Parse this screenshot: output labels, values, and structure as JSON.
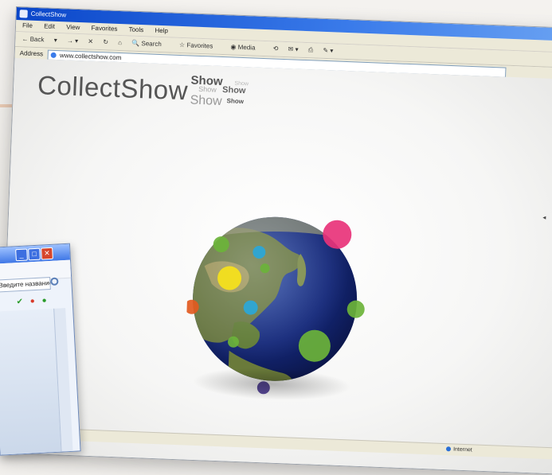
{
  "window": {
    "title": "CollectShow"
  },
  "menu": [
    "File",
    "Edit",
    "View",
    "Favorites",
    "Tools",
    "Help"
  ],
  "toolbar": {
    "back": "Back",
    "search": "Search",
    "favorites": "Favorites",
    "media": "Media"
  },
  "address": {
    "label": "Address",
    "url": "www.collectshow.com"
  },
  "logo": {
    "main": "CollectShow",
    "stack": [
      "Show",
      "Show",
      "Show",
      "Show",
      "Show",
      "Show"
    ]
  },
  "status": {
    "zone": "Internet"
  },
  "globe": {
    "markers": [
      {
        "color": "#e8337a",
        "name": "marker-pink"
      },
      {
        "color": "#6bb33a",
        "name": "marker-green-top"
      },
      {
        "color": "#2aa7d9",
        "name": "marker-blue-top"
      },
      {
        "color": "#f6e21a",
        "name": "marker-yellow"
      },
      {
        "color": "#6bb33a",
        "name": "marker-green-small"
      },
      {
        "color": "#e25a1f",
        "name": "marker-orange"
      },
      {
        "color": "#2aa7d9",
        "name": "marker-blue-mid"
      },
      {
        "color": "#6bb33a",
        "name": "marker-green-right"
      },
      {
        "color": "#6bb33a",
        "name": "marker-green-large"
      },
      {
        "color": "#6bb33a",
        "name": "marker-green-low"
      },
      {
        "color": "#4b3a8f",
        "name": "marker-purple"
      }
    ]
  },
  "popup": {
    "input": "Введите название"
  }
}
